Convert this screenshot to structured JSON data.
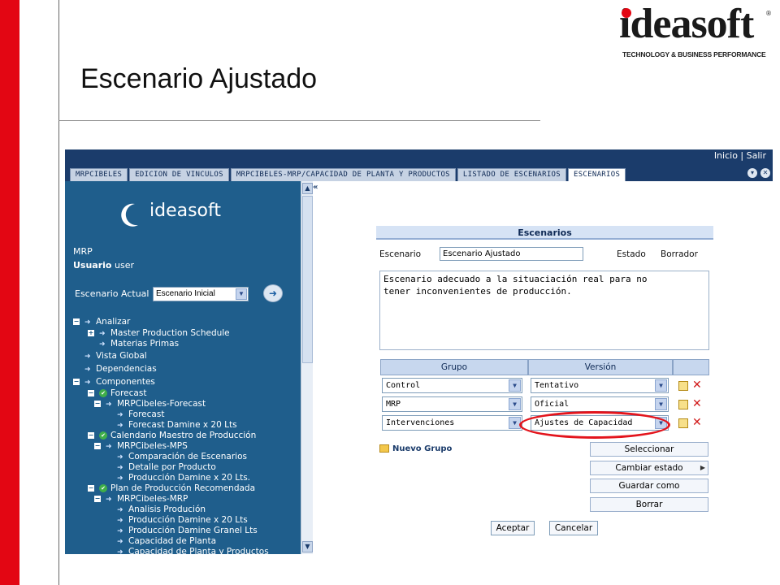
{
  "slide": {
    "title": "Escenario Ajustado",
    "logo": {
      "wordmark": "ideasoft",
      "registered": "®",
      "tagline": "TECHNOLOGY & BUSINESS PERFORMANCE"
    }
  },
  "app": {
    "top_links": {
      "inicio": "Inicio",
      "separator": "|",
      "salir": "Salir"
    },
    "tabs": [
      {
        "label": "MRPCIBELES"
      },
      {
        "label": "EDICION DE VINCULOS"
      },
      {
        "label": "MRPCIBELES-MRP/CAPACIDAD DE PLANTA Y PRODUCTOS"
      },
      {
        "label": "LISTADO DE ESCENARIOS"
      },
      {
        "label": "ESCENARIOS"
      }
    ],
    "sidebar": {
      "logo_text": "ideasoft",
      "module": "MRP",
      "user_label": "Usuario",
      "user_value": "user",
      "scenario_label": "Escenario Actual",
      "scenario_value": "Escenario Inicial",
      "tree": [
        {
          "level": 0,
          "toggle": "−",
          "icon": "arrow",
          "label": "Analizar"
        },
        {
          "level": 1,
          "toggle": "+",
          "icon": "arrow",
          "label": "Master Production Schedule"
        },
        {
          "level": 1,
          "toggle": "",
          "icon": "arrow",
          "label": "Materias Primas"
        },
        {
          "level": 0,
          "toggle": "",
          "icon": "arrow",
          "label": "Vista Global"
        },
        {
          "level": 0,
          "toggle": "",
          "icon": "arrow",
          "label": "Dependencias"
        },
        {
          "level": 0,
          "toggle": "−",
          "icon": "arrow",
          "label": "Componentes"
        },
        {
          "level": 1,
          "toggle": "−",
          "icon": "check",
          "label": "Forecast"
        },
        {
          "level": 2,
          "toggle": "−",
          "icon": "arrow",
          "label": "MRPCibeles-Forecast"
        },
        {
          "level": 3,
          "toggle": "",
          "icon": "arrow",
          "label": "Forecast"
        },
        {
          "level": 3,
          "toggle": "",
          "icon": "arrow",
          "label": "Forecast Damine x 20 Lts"
        },
        {
          "level": 1,
          "toggle": "−",
          "icon": "check",
          "label": "Calendario Maestro de Producción"
        },
        {
          "level": 2,
          "toggle": "−",
          "icon": "arrow",
          "label": "MRPCibeles-MPS"
        },
        {
          "level": 3,
          "toggle": "",
          "icon": "arrow",
          "label": "Comparación de Escenarios"
        },
        {
          "level": 3,
          "toggle": "",
          "icon": "arrow",
          "label": "Detalle por Producto"
        },
        {
          "level": 3,
          "toggle": "",
          "icon": "arrow",
          "label": "Producción Damine x 20 Lts."
        },
        {
          "level": 1,
          "toggle": "−",
          "icon": "check",
          "label": "Plan de Producción Recomendada"
        },
        {
          "level": 2,
          "toggle": "−",
          "icon": "arrow",
          "label": "MRPCibeles-MRP"
        },
        {
          "level": 3,
          "toggle": "",
          "icon": "arrow",
          "label": "Analisis Produción"
        },
        {
          "level": 3,
          "toggle": "",
          "icon": "arrow",
          "label": "Producción Damine x 20 Lts"
        },
        {
          "level": 3,
          "toggle": "",
          "icon": "arrow",
          "label": "Producción Damine Granel Lts"
        },
        {
          "level": 3,
          "toggle": "",
          "icon": "arrow",
          "label": "Capacidad de Planta"
        },
        {
          "level": 3,
          "toggle": "",
          "icon": "arrow",
          "label": "Capacidad de Planta y Productos"
        }
      ]
    },
    "form": {
      "header": "Escenarios",
      "escenario_label": "Escenario",
      "escenario_value": "Escenario Ajustado",
      "estado_label": "Estado",
      "estado_value": "Borrador",
      "description": "Escenario adecuado a la situaciación real para no\ntener inconvenientes de producción.",
      "grid_headers": {
        "grupo": "Grupo",
        "version": "Versión"
      },
      "rows": [
        {
          "grupo": "Control",
          "version": "Tentativo"
        },
        {
          "grupo": "MRP",
          "version": "Oficial"
        },
        {
          "grupo": "Intervenciones",
          "version": "Ajustes de Capacidad"
        }
      ],
      "nuevo_grupo": "Nuevo Grupo",
      "action_buttons": [
        "Seleccionar",
        "Cambiar estado",
        "Guardar como",
        "Borrar"
      ],
      "aceptar": "Aceptar",
      "cancelar": "Cancelar"
    }
  },
  "colors": {
    "slide_accent": "#e30613",
    "app_header": "#1b3c6b",
    "sidebar_bg": "#1f5e8c",
    "highlight": "#e3141c"
  }
}
